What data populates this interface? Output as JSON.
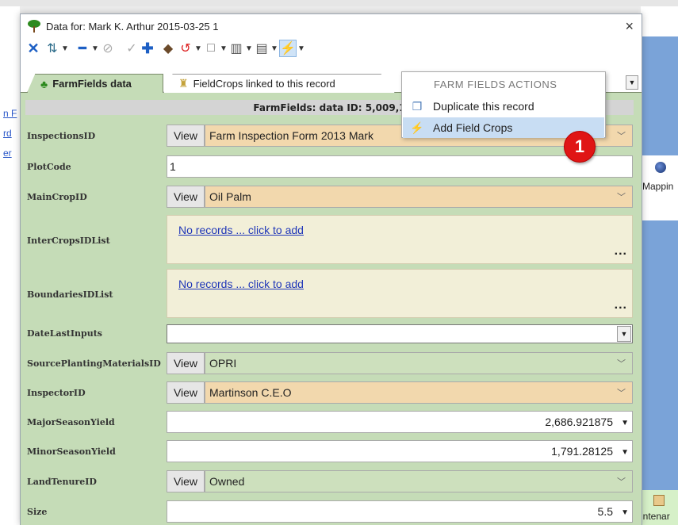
{
  "background": {
    "left_links": [
      "n F",
      "rd",
      "er"
    ],
    "right_tile_label": "Mappin",
    "right_bottom_label": "intenar"
  },
  "window": {
    "title": "Data for:  Mark K. Arthur 2015-03-25 1",
    "close_label": "×"
  },
  "tabs": [
    {
      "label": "FarmFields data",
      "active": true
    },
    {
      "label": "FieldCrops linked to this record",
      "active": false
    }
  ],
  "section_header": "FarmFields: data ID: 5,009,1",
  "view_label": "View",
  "fields": {
    "inspections": {
      "label": "InspectionsID",
      "value": "Farm Inspection Form 2013 Mark"
    },
    "plotcode": {
      "label": "PlotCode",
      "value": "1"
    },
    "maincrop": {
      "label": "MainCropID",
      "value": "Oil Palm"
    },
    "intercrops": {
      "label": "InterCropsIDList",
      "link": "No records ... click to add",
      "more": "..."
    },
    "boundaries": {
      "label": "BoundariesIDList",
      "link": "No records ... click to add",
      "more": "..."
    },
    "datelast": {
      "label": "DateLastInputs",
      "value": ""
    },
    "sourceplanting": {
      "label": "SourcePlantingMaterialsID",
      "value": "OPRI"
    },
    "inspector": {
      "label": "InspectorID",
      "value": "Martinson C.E.O"
    },
    "majorseason": {
      "label": "MajorSeasonYield",
      "value": "2,686.921875"
    },
    "minorseason": {
      "label": "MinorSeasonYield",
      "value": "1,791.28125"
    },
    "landtenure": {
      "label": "LandTenureID",
      "value": "Owned"
    },
    "size": {
      "label": "Size",
      "value": "5.5"
    }
  },
  "menu": {
    "header": "FARM FIELDS ACTIONS",
    "items": [
      {
        "label": "Duplicate this record",
        "icon": "copy-icon",
        "highlighted": false
      },
      {
        "label": "Add Field Crops",
        "icon": "lightning-icon",
        "highlighted": true
      }
    ]
  },
  "badge": "1"
}
